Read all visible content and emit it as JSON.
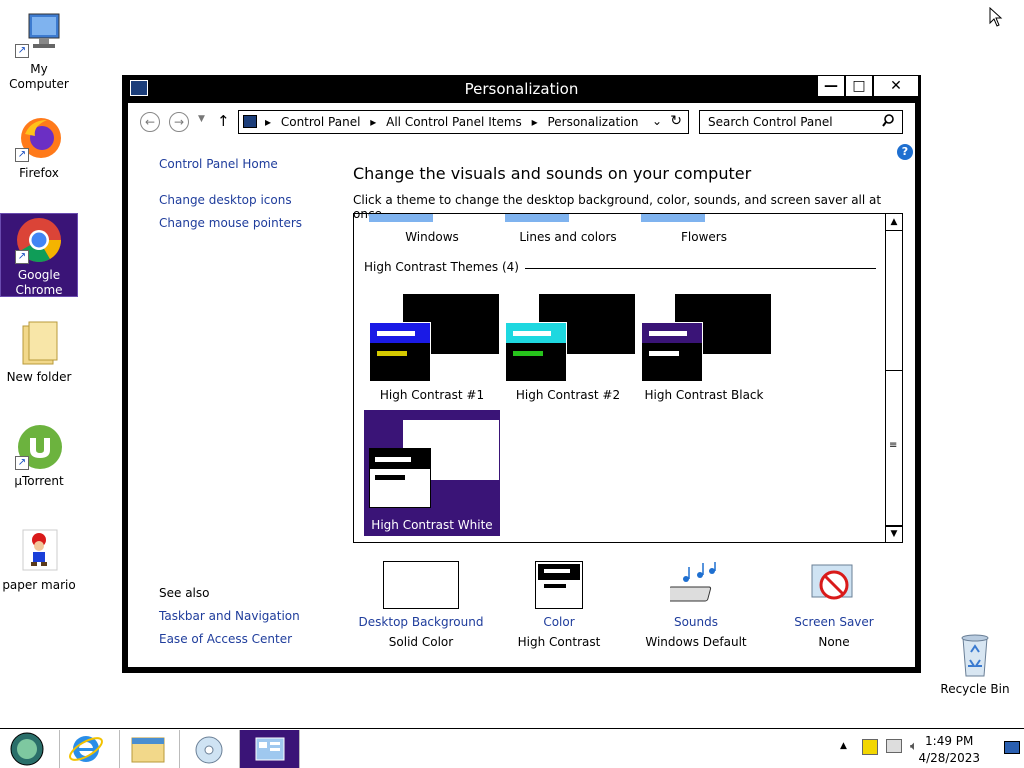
{
  "desktop": {
    "icons": [
      {
        "label": "My Computer"
      },
      {
        "label": "Firefox"
      },
      {
        "label": "Google Chrome"
      },
      {
        "label": "New folder"
      },
      {
        "label": "µTorrent"
      },
      {
        "label": "paper mario"
      },
      {
        "label": "Recycle Bin"
      }
    ]
  },
  "window": {
    "title": "Personalization",
    "buttons": {
      "minimize": "—",
      "maximize": "□",
      "close": "✕"
    }
  },
  "address": {
    "crumbs": [
      "Control Panel",
      "All Control Panel Items",
      "Personalization"
    ]
  },
  "search": {
    "placeholder": "Search Control Panel"
  },
  "left_panel": {
    "links": [
      "Control Panel Home",
      "Change desktop icons",
      "Change mouse pointers"
    ],
    "see_also_label": "See also",
    "see_also": [
      "Taskbar and Navigation",
      "Ease of Access Center"
    ]
  },
  "main": {
    "heading": "Change the visuals and sounds on your computer",
    "subtext": "Click a theme to change the desktop background, color, sounds, and screen saver all at once."
  },
  "themes": {
    "top_row": [
      "Windows",
      "Lines and colors",
      "Flowers"
    ],
    "group_title": "High Contrast Themes (4)",
    "high_contrast": [
      {
        "name": "High Contrast #1",
        "front_header": "#1a1ae6",
        "bar_color": "#d4c800"
      },
      {
        "name": "High Contrast #2",
        "front_header": "#1ed8e0",
        "bar_color": "#27c41c"
      },
      {
        "name": "High Contrast Black",
        "front_header": "#3a1477",
        "bar_color": "#ffffff"
      },
      {
        "name": "High Contrast White",
        "selected": true
      }
    ]
  },
  "options": [
    {
      "title": "Desktop Background",
      "value": "Solid Color"
    },
    {
      "title": "Color",
      "value": "High Contrast"
    },
    {
      "title": "Sounds",
      "value": "Windows Default"
    },
    {
      "title": "Screen Saver",
      "value": "None"
    }
  ],
  "taskbar": {
    "time": "1:49 PM",
    "date": "4/28/2023"
  },
  "colors": {
    "accent_selected": "#3a1477",
    "link": "#1f3d9c"
  }
}
